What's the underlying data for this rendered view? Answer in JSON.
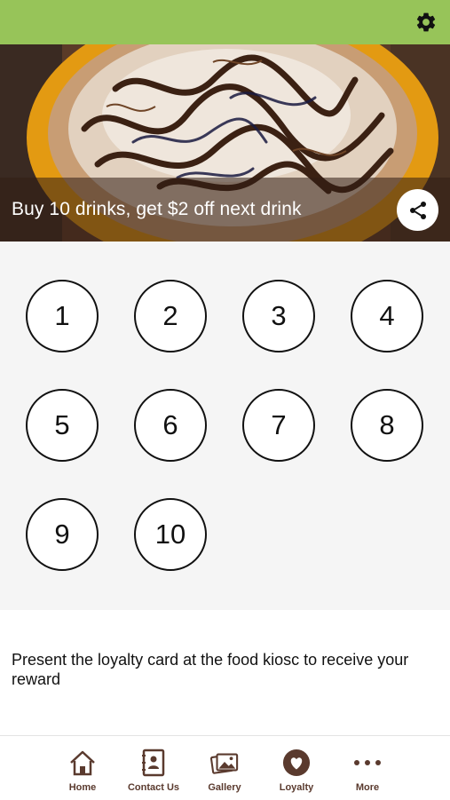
{
  "header": {
    "settings_icon": "gear-icon"
  },
  "hero": {
    "caption": "Buy 10 drinks, get $2 off next drink",
    "share_icon": "share-icon"
  },
  "stamps": [
    "1",
    "2",
    "3",
    "4",
    "5",
    "6",
    "7",
    "8",
    "9",
    "10"
  ],
  "note": "Present the loyalty card at the food kiosc to receive your reward",
  "nav": {
    "items": [
      {
        "label": "Home",
        "icon": "home-icon"
      },
      {
        "label": "Contact Us",
        "icon": "contact-book-icon"
      },
      {
        "label": "Gallery",
        "icon": "gallery-icon"
      },
      {
        "label": "Loyalty",
        "icon": "heart-icon"
      },
      {
        "label": "More",
        "icon": "more-dots-icon"
      }
    ]
  },
  "colors": {
    "header_green": "#97c459",
    "nav_brown": "#5a3a2e",
    "stamp_border": "#111111"
  }
}
